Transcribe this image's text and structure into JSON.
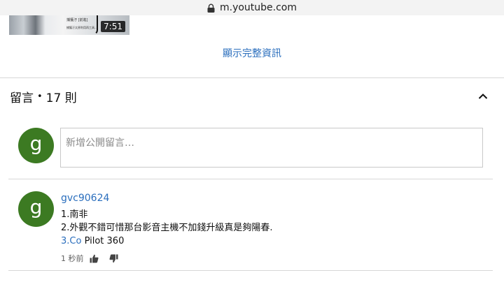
{
  "browser": {
    "url": "m.youtube.com"
  },
  "video": {
    "duration": "7:51",
    "caption_line1": "捕獲汙 [前進]",
    "caption_line2": "捕獲汙太原利用再工具…"
  },
  "description": {
    "show_more_label": "顯示完整資訊"
  },
  "comments": {
    "title": "留言",
    "separator": "•",
    "count_label": "17 則",
    "new_comment": {
      "avatar_letter": "g",
      "placeholder": "新增公開留言…"
    },
    "items": [
      {
        "avatar_letter": "g",
        "author": "gvc90624",
        "line1": "1.南非",
        "line2": "2.外觀不錯可惜那台影音主機不加錢升級真是夠陽春.",
        "line3_link": "3.Co",
        "line3_rest": " Pilot 360",
        "time": "1 秒前"
      }
    ]
  },
  "colors": {
    "link": "#2a6ebd",
    "avatar": "#3c7a22"
  }
}
